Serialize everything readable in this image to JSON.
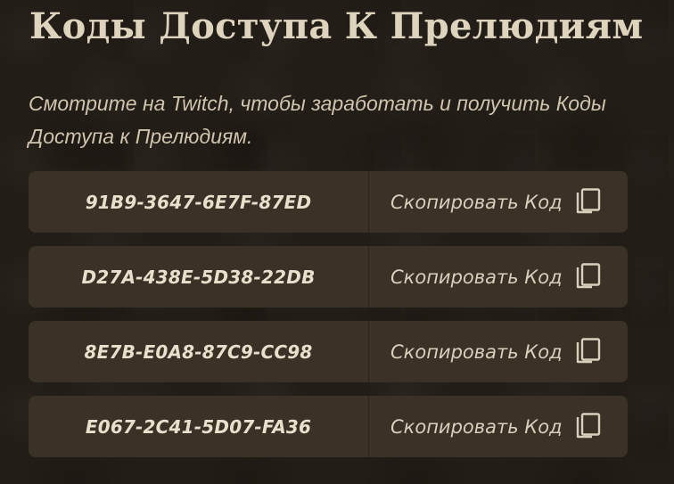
{
  "page": {
    "title": "Коды Доступа К Прелюдиям",
    "subtitle": "Смотрите на Twitch, чтобы заработать и получить Коды Доступа к Прелюдиям."
  },
  "codes": [
    {
      "code": "91B9-3647-6E7F-87ED",
      "copy_label": "Скопировать Код",
      "icon": "copy-icon"
    },
    {
      "code": "D27A-438E-5D38-22DB",
      "copy_label": "Скопировать Код",
      "icon": "copy-icon"
    },
    {
      "code": "8E7B-E0A8-87C9-CC98",
      "copy_label": "Скопировать Код",
      "icon": "copy-icon"
    },
    {
      "code": "E067-2C41-5D07-FA36",
      "copy_label": "Скопировать Код",
      "icon": "copy-icon"
    }
  ],
  "colors": {
    "background": "#231d17",
    "row_background": "#3a3127",
    "title_text": "#ded3bd",
    "code_text": "#e8dfcc"
  }
}
